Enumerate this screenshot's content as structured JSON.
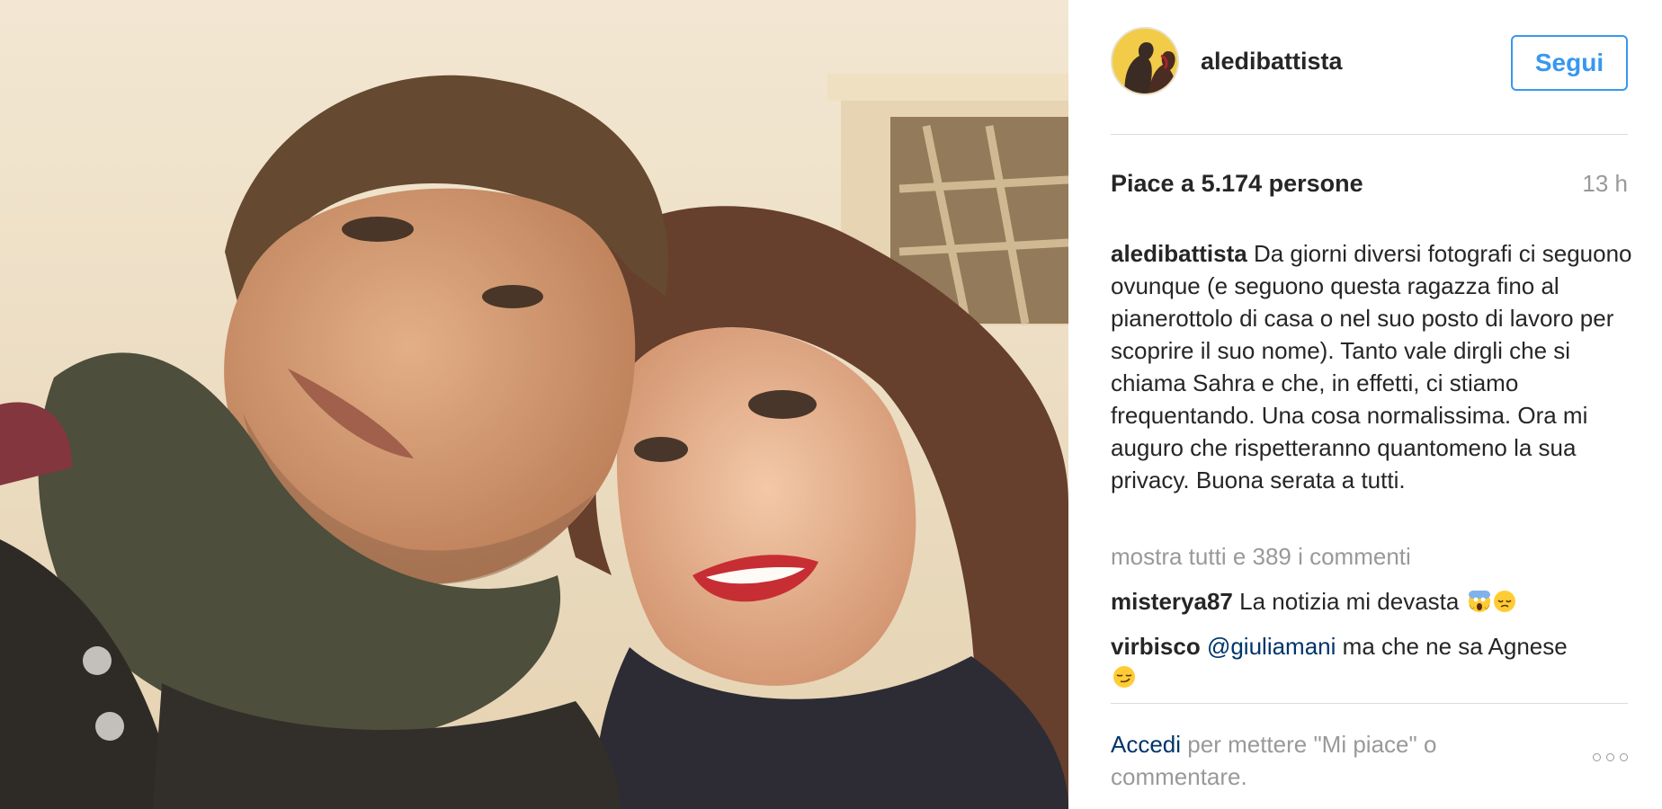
{
  "post": {
    "username": "aledibattista",
    "follow_label": "Segui",
    "likes": "Piace a 5.174 persone",
    "time_ago": "13 h",
    "caption_user": "aledibattista",
    "caption_text": "Da giorni diversi fotografi ci seguono ovunque (e seguono questa ragazza fino al pianerottolo di casa o nel suo posto di lavoro per scoprire il suo nome). Tanto vale dirgli che si chiama Sahra e che, in effetti, ci stiamo frequentando. Una cosa normalissima. Ora mi auguro che rispetteranno quantomeno la sua privacy. Buona serata a tutti.",
    "view_all_comments": "mostra tutti e 389 i commenti"
  },
  "comments": [
    {
      "user": "misterya87",
      "mention": "",
      "text": "La notizia mi devasta",
      "emojis": [
        "screaming-face-emoji",
        "pensive-face-emoji"
      ]
    },
    {
      "user": "virbisco",
      "mention": "@giuliamani",
      "text": "ma che ne sa Agnese",
      "emojis": [
        "smirking-face-emoji"
      ]
    }
  ],
  "footer": {
    "login_link": "Accedi",
    "login_text": "per mettere \"Mi piace\" o commentare."
  },
  "icons": {
    "more": "more-options-icon"
  },
  "colors": {
    "accent": "#3897f0",
    "link": "#003569",
    "muted": "#999999",
    "text": "#262626"
  }
}
